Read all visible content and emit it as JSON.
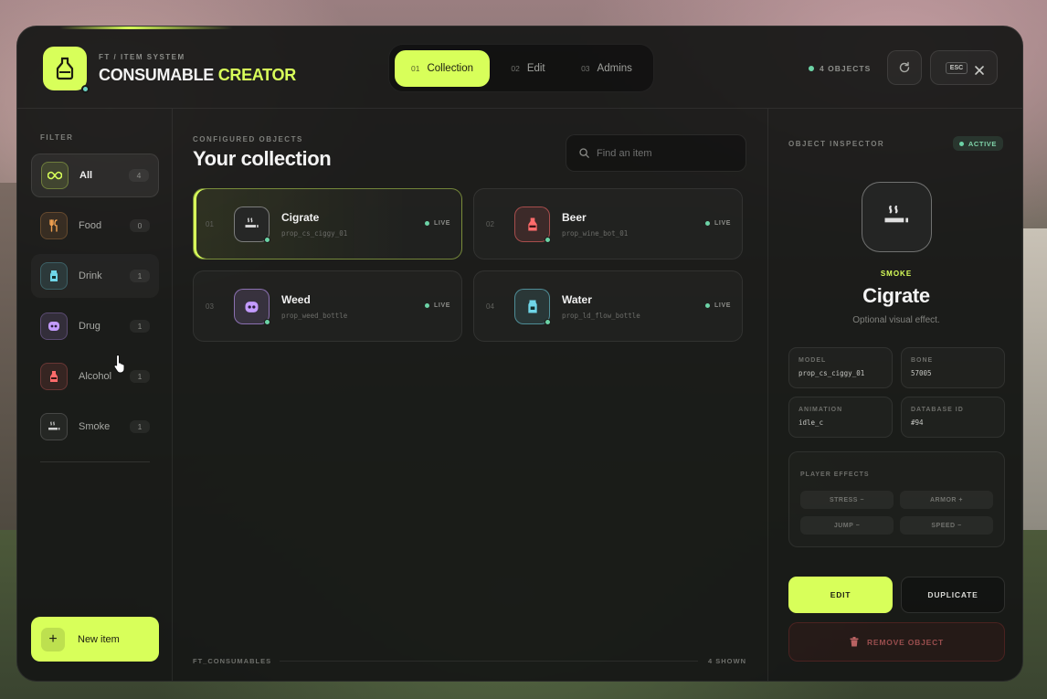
{
  "header": {
    "subtitle": "FT / ITEM SYSTEM",
    "title_main": "CONSUMABLE",
    "title_accent": "CREATOR",
    "object_count": "4 OBJECTS",
    "esc_label": "ESC",
    "tabs": [
      {
        "num": "01",
        "label": "Collection",
        "active": true
      },
      {
        "num": "02",
        "label": "Edit",
        "active": false
      },
      {
        "num": "03",
        "label": "Admins",
        "active": false
      }
    ]
  },
  "sidebar": {
    "section_label": "FILTER",
    "items": [
      {
        "label": "All",
        "count": "4",
        "icon": "infinity-icon",
        "active": true
      },
      {
        "label": "Food",
        "count": "0",
        "icon": "cutlery-icon"
      },
      {
        "label": "Drink",
        "count": "1",
        "icon": "cup-icon"
      },
      {
        "label": "Drug",
        "count": "1",
        "icon": "pill-icon"
      },
      {
        "label": "Alcohol",
        "count": "1",
        "icon": "bottle-icon"
      },
      {
        "label": "Smoke",
        "count": "1",
        "icon": "smoke-icon"
      }
    ],
    "new_item_label": "New item"
  },
  "main": {
    "section_label": "CONFIGURED OBJECTS",
    "title": "Your collection",
    "search_placeholder": "Find an item",
    "items": [
      {
        "num": "01",
        "name": "Cigrate",
        "model": "prop_cs_ciggy_01",
        "status": "LIVE",
        "icon": "smoke-icon",
        "color": "#cfcfcf"
      },
      {
        "num": "02",
        "name": "Beer",
        "model": "prop_wine_bot_01",
        "status": "LIVE",
        "icon": "bottle-icon",
        "color": "#ff6b6b"
      },
      {
        "num": "03",
        "name": "Weed",
        "model": "prop_weed_bottle",
        "status": "LIVE",
        "icon": "pill-icon",
        "color": "#c39bff"
      },
      {
        "num": "04",
        "name": "Water",
        "model": "prop_ld_flow_bottle",
        "status": "LIVE",
        "icon": "cup-icon",
        "color": "#6fd6e8"
      }
    ],
    "footer_label": "FT_CONSUMABLES",
    "footer_count": "4 SHOWN"
  },
  "inspector": {
    "section_label": "OBJECT INSPECTOR",
    "status": "ACTIVE",
    "category": "SMOKE",
    "name": "Cigrate",
    "description": "Optional visual effect.",
    "props": [
      {
        "label": "MODEL",
        "value": "prop_cs_ciggy_01"
      },
      {
        "label": "BONE",
        "value": "57005"
      },
      {
        "label": "ANIMATION",
        "value": "idle_c"
      },
      {
        "label": "DATABASE ID",
        "value": "#94"
      }
    ],
    "effects_label": "PLAYER EFFECTS",
    "effects": [
      "STRESS −",
      "ARMOR +",
      "JUMP −",
      "SPEED −"
    ],
    "edit_label": "EDIT",
    "duplicate_label": "DUPLICATE",
    "remove_label": "REMOVE OBJECT"
  },
  "colors": {
    "accent": "#d8ff5a",
    "live": "#6cd3a6",
    "food": "#f0a050",
    "drink": "#6fd6e8",
    "drug": "#c39bff",
    "alcohol": "#ff6b6b",
    "smoke": "#cfcfcf"
  }
}
